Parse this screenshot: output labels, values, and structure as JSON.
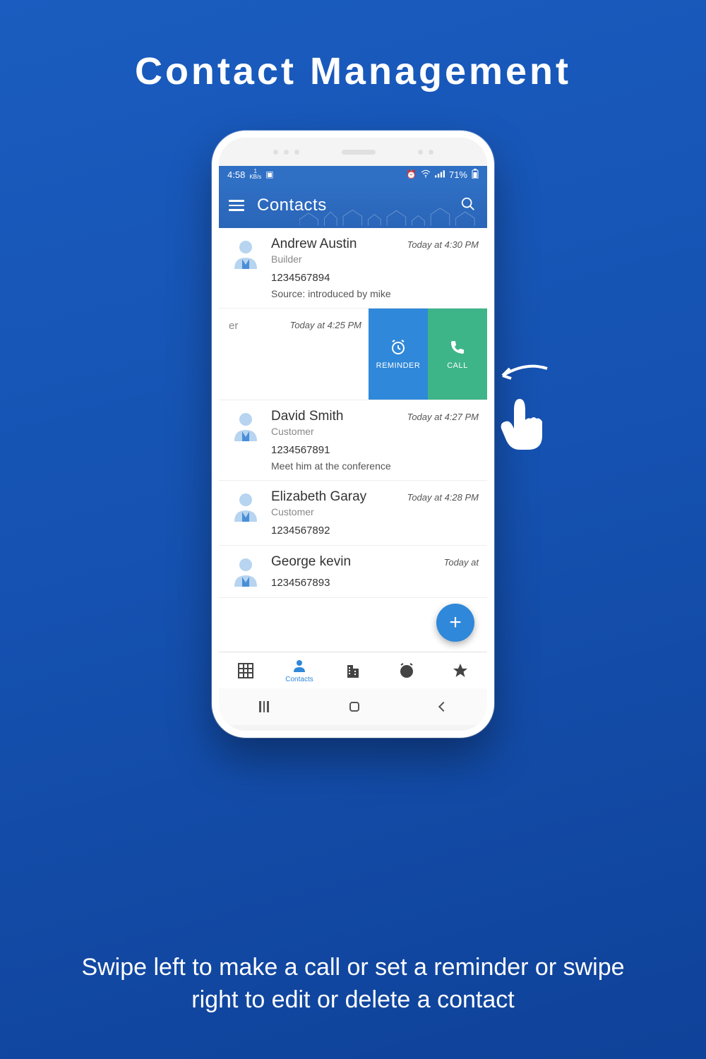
{
  "page": {
    "title": "Contact Management",
    "subtitle": "Swipe left to make a call or set a reminder or swipe right to edit or delete a contact"
  },
  "status": {
    "time": "4:58",
    "net_rate": "1",
    "net_unit": "KB/s",
    "battery": "71%"
  },
  "appbar": {
    "title": "Contacts"
  },
  "contacts": [
    {
      "name": "Andrew Austin",
      "role": "Builder",
      "phone": "1234567894",
      "note": "Source: introduced by mike",
      "time": "Today at 4:30 PM"
    },
    {
      "name_fragment": "er",
      "time": "Today at 4:25 PM"
    },
    {
      "name": "David Smith",
      "role": "Customer",
      "phone": "1234567891",
      "note": "Meet him at the conference",
      "time": "Today at 4:27 PM"
    },
    {
      "name": "Elizabeth Garay",
      "role": "Customer",
      "phone": "1234567892",
      "note": "",
      "time": "Today at 4:28 PM"
    },
    {
      "name": "George kevin",
      "role": "",
      "phone": "1234567893",
      "note": "",
      "time": "Today at"
    }
  ],
  "swipe_actions": {
    "reminder": "REMINDER",
    "call": "CALL"
  },
  "tabs": {
    "contacts": "Contacts"
  }
}
